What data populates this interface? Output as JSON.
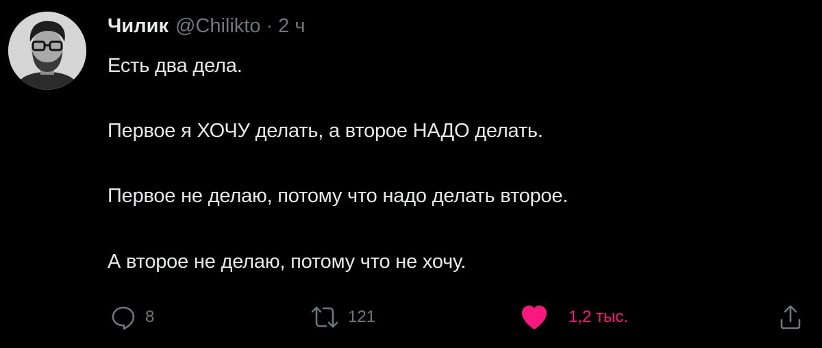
{
  "author": {
    "name": "Чилик",
    "handle": "@Chilikto",
    "separator": "·",
    "time": "2 ч"
  },
  "tweet": {
    "lines": [
      "Есть два дела.",
      "Первое я ХОЧУ делать, а второе НАДО делать.",
      "Первое не делаю, потому что надо делать второе.",
      "А второе не делаю, потому что не хочу."
    ]
  },
  "actions": {
    "reply": {
      "icon": "reply-icon",
      "count": "8"
    },
    "retweet": {
      "icon": "retweet-icon",
      "count": "121"
    },
    "like": {
      "icon": "heart-icon",
      "count": "1,2 тыс.",
      "liked": true
    },
    "share": {
      "icon": "share-icon"
    }
  },
  "colors": {
    "background": "#000000",
    "text": "#e7e9ea",
    "muted": "#71767b",
    "like": "#f91880"
  }
}
